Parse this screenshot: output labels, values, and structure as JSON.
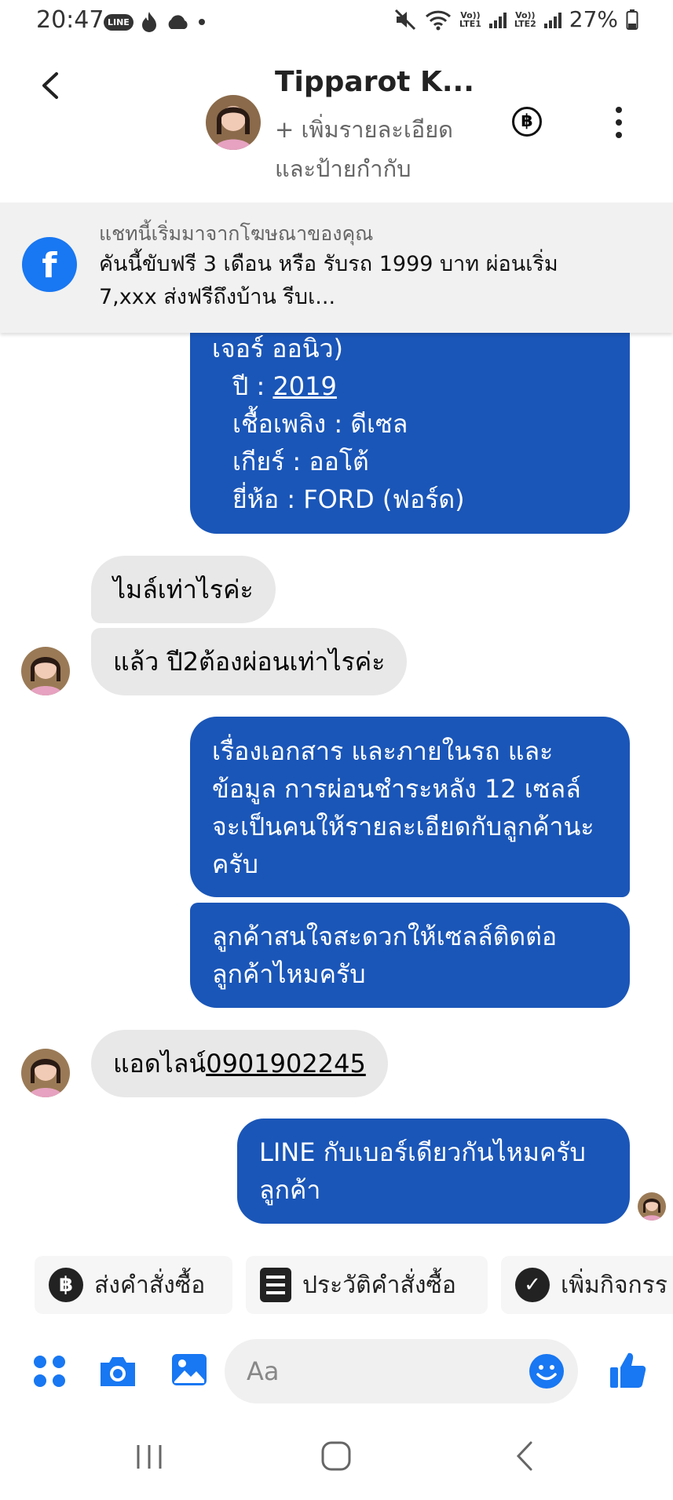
{
  "status_bar": {
    "time": "20:47",
    "line_badge": "LINE",
    "lte1": "LTE1",
    "lte2": "LTE2",
    "volte": "Vo))",
    "battery": "27%"
  },
  "header": {
    "contact_name": "Tipparot K...",
    "subtitle": "+ เพิ่มรายละเอียดและป้ายกำกับ",
    "baht_symbol": "฿"
  },
  "ad_banner": {
    "label": "แชทนี้เริ่มมาจากโฆษณาของคุณ",
    "text": "คันนี้ขับฟรี 3 เดือน หรือ รับรถ 1999 บาท ผ่อนเริ่ม 7,xxx ส่งฟรีถึงบ้าน รีบเ...",
    "fb_glyph": "f"
  },
  "messages": {
    "m1": {
      "line0": "เจอร์ ออนิว)",
      "line1_prefix": "ปี : ",
      "line1_link": "2019",
      "line2": "เชื้อเพลิง : ดีเซล",
      "line3": "เกียร์ : ออโต้",
      "line4": "ยี่ห้อ : FORD (ฟอร์ด)"
    },
    "m2": "ไมล์เท่าไรค่ะ",
    "m3": "แล้ว ปี2ต้องผ่อนเท่าไรค่ะ",
    "m4": "เรื่องเอกสาร และภายในรถ และข้อมูล การผ่อนชำระหลัง 12 เซลล์จะเป็นคนให้รายละเอียดกับลูกค้านะครับ",
    "m5": "ลูกค้าสนใจสะดวกให้เซลล์ติดต่อลูกค้าไหมครับ",
    "m6_prefix": "แอดไลน์",
    "m6_link": "0901902245",
    "m7": "LINE กับเบอร์เดียวกันไหมครับ ลูกค้า"
  },
  "quick_actions": {
    "send_order": "ส่งคำสั่งซื้อ",
    "order_history": "ประวัติคำสั่งซื้อ",
    "add_activity": "เพิ่มกิจกรร"
  },
  "composer": {
    "placeholder": "Aa"
  },
  "colors": {
    "outgoing_bubble": "#1a56b8",
    "incoming_bubble": "#e8e8e8",
    "messenger_blue": "#1877f2"
  }
}
